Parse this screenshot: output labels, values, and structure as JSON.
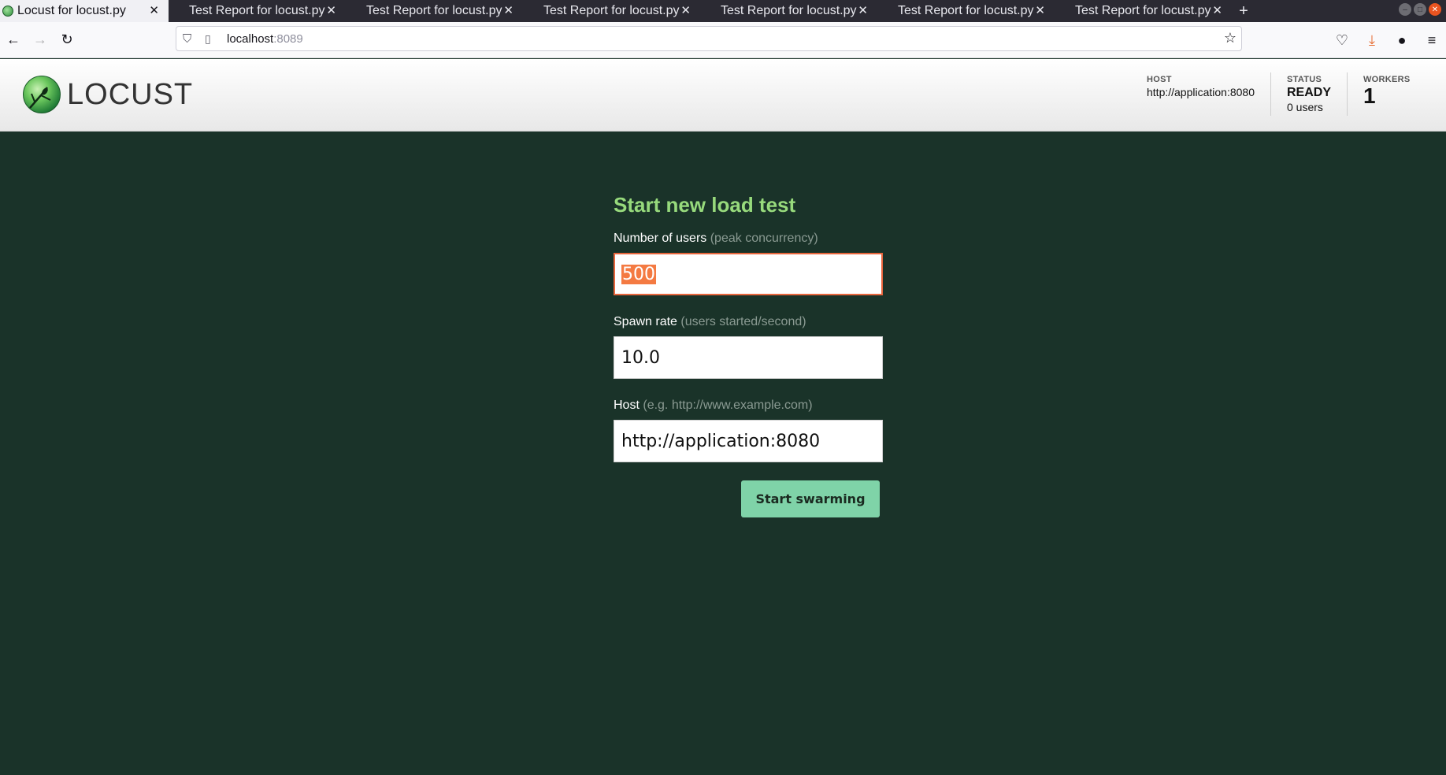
{
  "browser": {
    "tabs": [
      {
        "title": "Locust for locust.py",
        "active": true
      },
      {
        "title": "Test Report for locust.py",
        "active": false
      },
      {
        "title": "Test Report for locust.py",
        "active": false
      },
      {
        "title": "Test Report for locust.py",
        "active": false
      },
      {
        "title": "Test Report for locust.py",
        "active": false
      },
      {
        "title": "Test Report for locust.py",
        "active": false
      },
      {
        "title": "Test Report for locust.py",
        "active": false
      }
    ],
    "url": {
      "host": "localhost",
      "port": ":8089"
    }
  },
  "header": {
    "logo_text": "LOCUST",
    "host_label": "HOST",
    "host_value": "http://application:8080",
    "status_label": "STATUS",
    "status_value": "READY",
    "status_users": "0 users",
    "workers_label": "WORKERS",
    "workers_value": "1"
  },
  "form": {
    "title": "Start new load test",
    "users": {
      "label": "Number of users",
      "hint": "(peak concurrency)",
      "value": "500"
    },
    "spawn": {
      "label": "Spawn rate",
      "hint": "(users started/second)",
      "value": "10.0"
    },
    "host": {
      "label": "Host",
      "hint": "(e.g. http://www.example.com)",
      "value": "http://application:8080"
    },
    "submit_label": "Start swarming"
  },
  "colors": {
    "page_bg": "#1a3329",
    "title_green": "#97da7c",
    "button_bg": "#7fd3a8",
    "focus_border": "#e8663d"
  }
}
